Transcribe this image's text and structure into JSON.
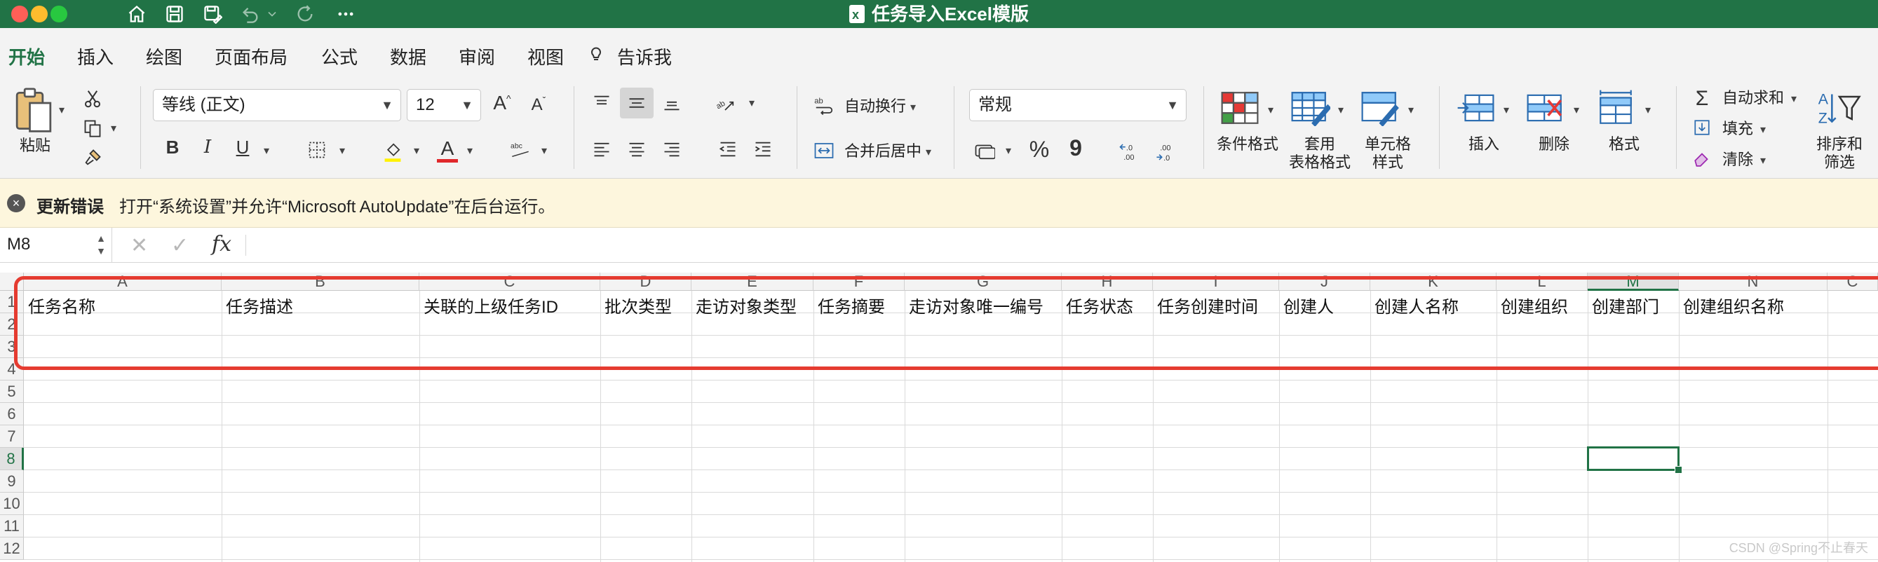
{
  "window": {
    "title": "任务导入Excel模版",
    "colors": {
      "brand": "#217346",
      "titlebar": "#217346",
      "annotation": "#e53b30"
    }
  },
  "titlebar_icons": [
    "home-icon",
    "save-icon",
    "save-as-icon",
    "undo-icon",
    "redo-icon",
    "more-icon"
  ],
  "menu": {
    "tabs": [
      "开始",
      "插入",
      "绘图",
      "页面布局",
      "公式",
      "数据",
      "审阅",
      "视图"
    ],
    "tell_me": "告诉我",
    "active": "开始"
  },
  "ribbon": {
    "paste_label": "粘贴",
    "font_name": "等线 (正文)",
    "font_size": "12",
    "wrap_text_label": "自动换行",
    "merge_center_label": "合并后居中",
    "number_format": "常规",
    "conditional_format_label": "条件格式",
    "table_format_label": "套用\n表格格式",
    "cell_style_label": "单元格\n样式",
    "insert_label": "插入",
    "delete_label": "删除",
    "format_label": "格式",
    "autosum_label": "自动求和",
    "fill_label": "填充",
    "clear_label": "清除",
    "sort_filter_label": "排序和\n筛选",
    "bold": "B",
    "italic": "I",
    "underline": "U",
    "percent": "%",
    "comma": "9",
    "increase_font": "A",
    "decrease_font": "A",
    "font_color_letter": "A"
  },
  "notification": {
    "title": "更新错误",
    "message": "打开“系统设置”并允许“Microsoft AutoUpdate”在后台运行。"
  },
  "formula_bar": {
    "name_box": "M8",
    "fx": "fx",
    "content": ""
  },
  "sheet": {
    "columns": [
      "A",
      "B",
      "C",
      "D",
      "E",
      "F",
      "G",
      "H",
      "I",
      "J",
      "K",
      "L",
      "M",
      "N",
      "C"
    ],
    "rows": [
      "1",
      "2",
      "3",
      "4",
      "5",
      "6",
      "7",
      "8",
      "9",
      "10",
      "11",
      "12"
    ],
    "header_row": [
      "任务名称",
      "任务描述",
      "关联的上级任务ID",
      "批次类型",
      "走访对象类型",
      "任务摘要",
      "走访对象唯一编号",
      "任务状态",
      "任务创建时间",
      "创建人",
      "创建人名称",
      "创建组织",
      "创建部门",
      "创建组织名称"
    ],
    "selected_column": "M",
    "selected_row": "8"
  },
  "watermark": "CSDN @Spring不止春天"
}
